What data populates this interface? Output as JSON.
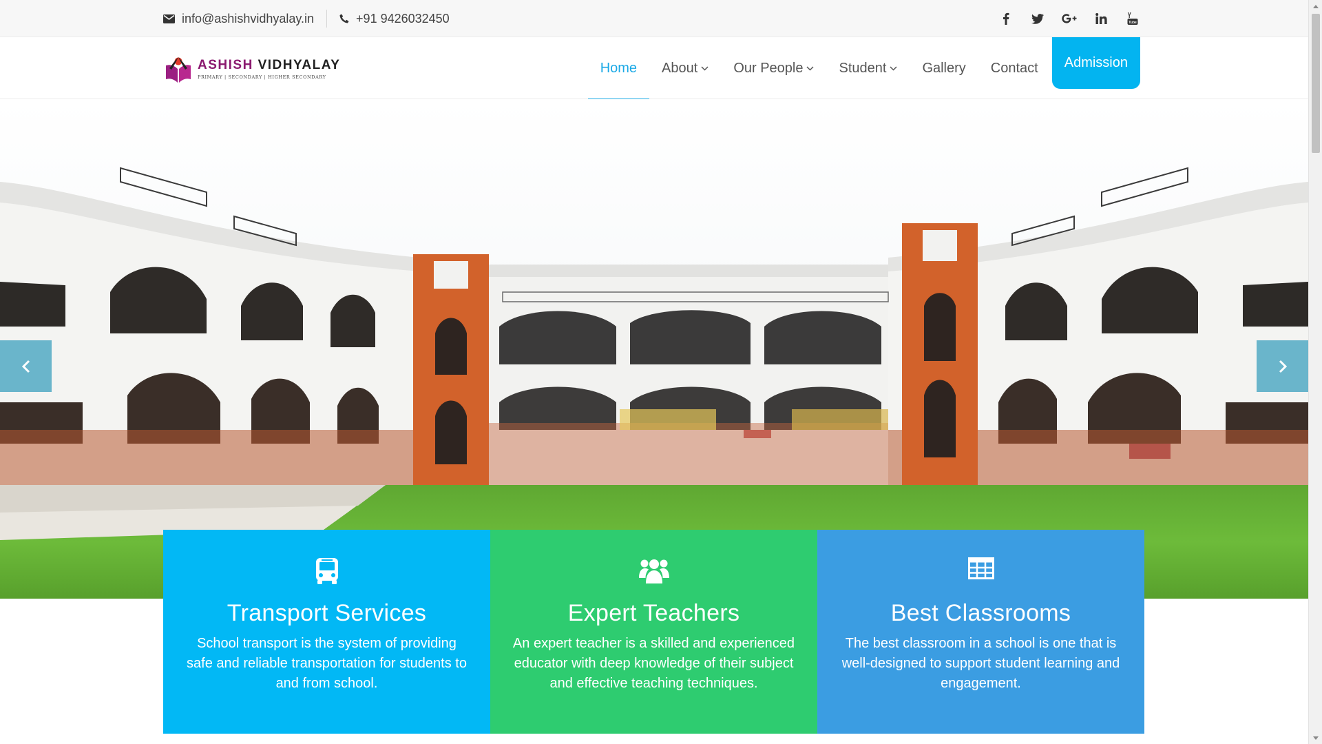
{
  "topbar": {
    "email": "info@ashishvidhyalay.in",
    "phone": "+91 9426032450",
    "social_icons": [
      "facebook-icon",
      "twitter-icon",
      "google-plus-icon",
      "linkedin-icon",
      "youtube-icon"
    ]
  },
  "logo": {
    "name_part1": "ASHISH",
    "name_part2": "VIDHYALAY",
    "tagline": "PRIMARY | SECONDARY | HIGHER SECONDARY"
  },
  "nav": {
    "home": "Home",
    "about": "About",
    "our_people": "Our People",
    "student": "Student",
    "gallery": "Gallery",
    "contact": "Contact",
    "admission": "Admission"
  },
  "hero": {
    "prev_icon": "chevron-left-icon",
    "next_icon": "chevron-right-icon"
  },
  "features": [
    {
      "title": "Transport Services",
      "text": "School transport is the system of providing safe and reliable transportation for students to and from school.",
      "icon": "bus-icon",
      "color": "#02b8f5"
    },
    {
      "title": "Expert Teachers",
      "text": "An expert teacher is a skilled and experienced educator with deep knowledge of their subject and effective teaching techniques.",
      "icon": "users-icon",
      "color": "#2ecc70"
    },
    {
      "title": "Best Classrooms",
      "text": "The best classroom in a school is one that is well-designed to support student learning and engagement.",
      "icon": "table-grid-icon",
      "color": "#3b9de2"
    }
  ],
  "colors": {
    "accent": "#1ba9e6",
    "admission_bg": "#03b4f0",
    "brand_purple": "#8b1a6f"
  }
}
